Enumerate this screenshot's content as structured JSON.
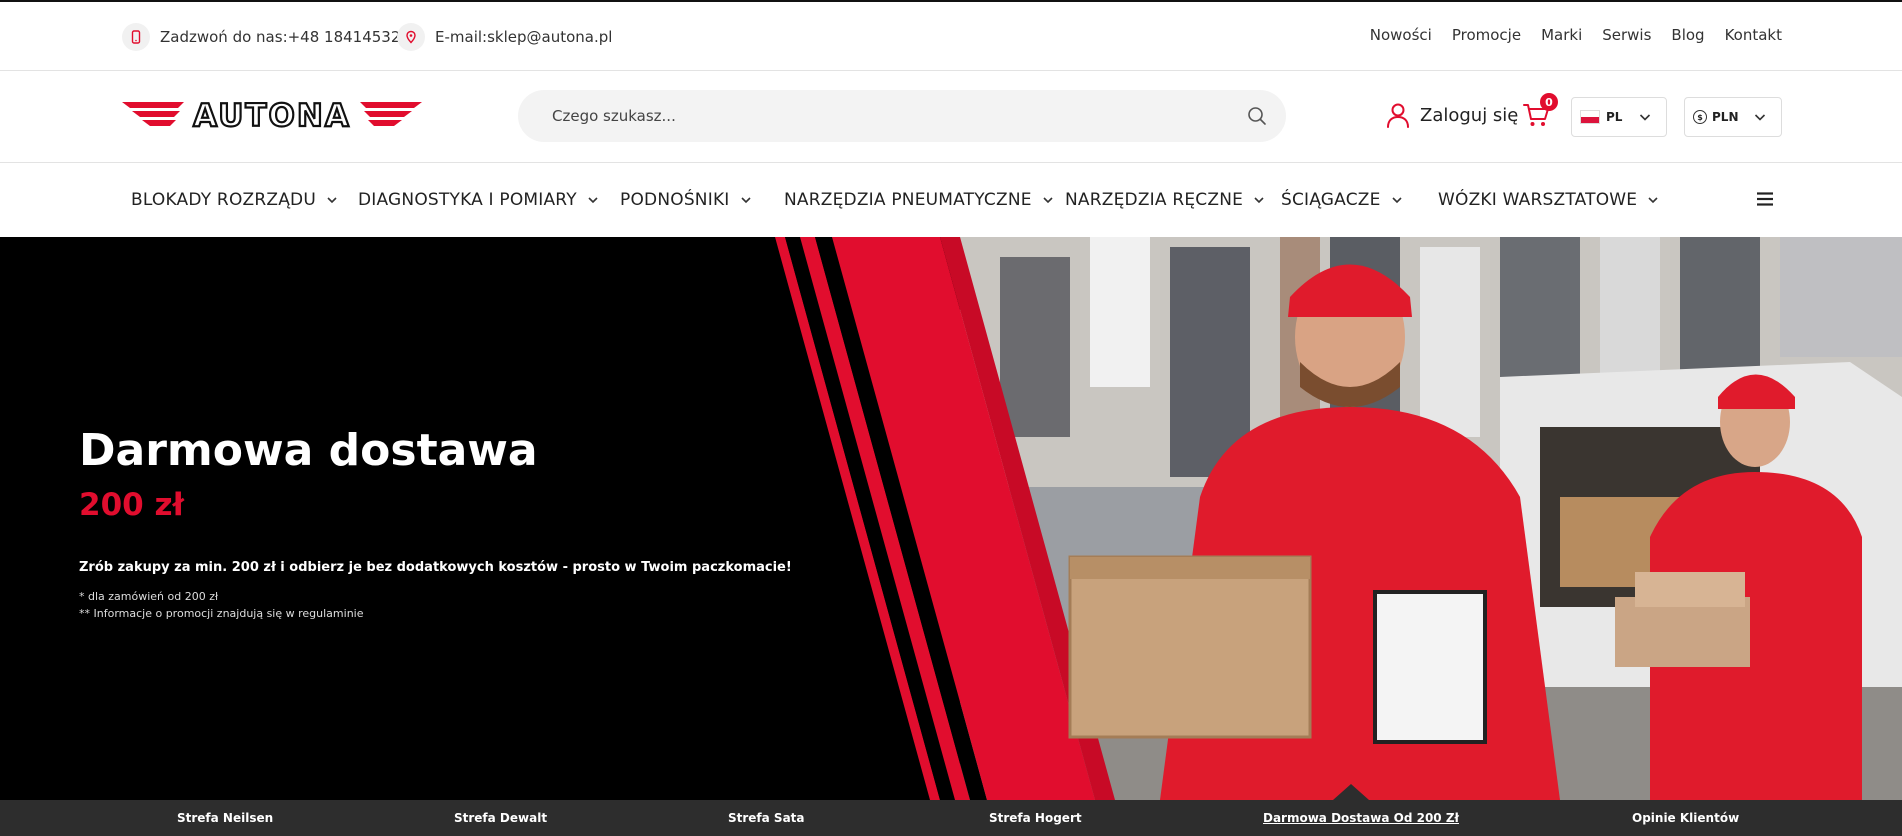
{
  "topbar": {
    "phone": "Zadzwoń do nas:+48 184145324",
    "email": "E-mail:sklep@autona.pl",
    "links": [
      "Nowości",
      "Promocje",
      "Marki",
      "Serwis",
      "Blog",
      "Kontakt"
    ]
  },
  "header": {
    "logo_text": "AUTONA",
    "search_placeholder": "Czego szukasz...",
    "login_label": "Zaloguj się",
    "cart_count": "0",
    "language": "PL",
    "currency": "PLN"
  },
  "categories": [
    "BLOKADY ROZRZĄDU",
    "DIAGNOSTYKA I POMIARY",
    "PODNOŚNIKI",
    "NARZĘDZIA PNEUMATYCZNE",
    "NARZĘDZIA RĘCZNE",
    "ŚCIĄGACZE",
    "WÓZKI WARSZTATOWE"
  ],
  "hero": {
    "title": "Darmowa dostawa",
    "price": "200 zł",
    "description": "Zrób zakupy za min. 200 zł i odbierz je bez dodatkowych kosztów - prosto w Twoim paczkomacie!",
    "note1": "* dla zamówień od 200 zł",
    "note2": "** Informacje o promocji znajdują się w regulaminie"
  },
  "tabs": {
    "items": [
      "Strefa Neilsen",
      "Strefa Dewalt",
      "Strefa Sata",
      "Strefa Hogert",
      "Darmowa Dostawa Od 200 Zł",
      "Opinie Klientów"
    ],
    "active_index": 4
  },
  "colors": {
    "accent": "#e10d2e",
    "dark_bar": "#2d2d2d"
  }
}
